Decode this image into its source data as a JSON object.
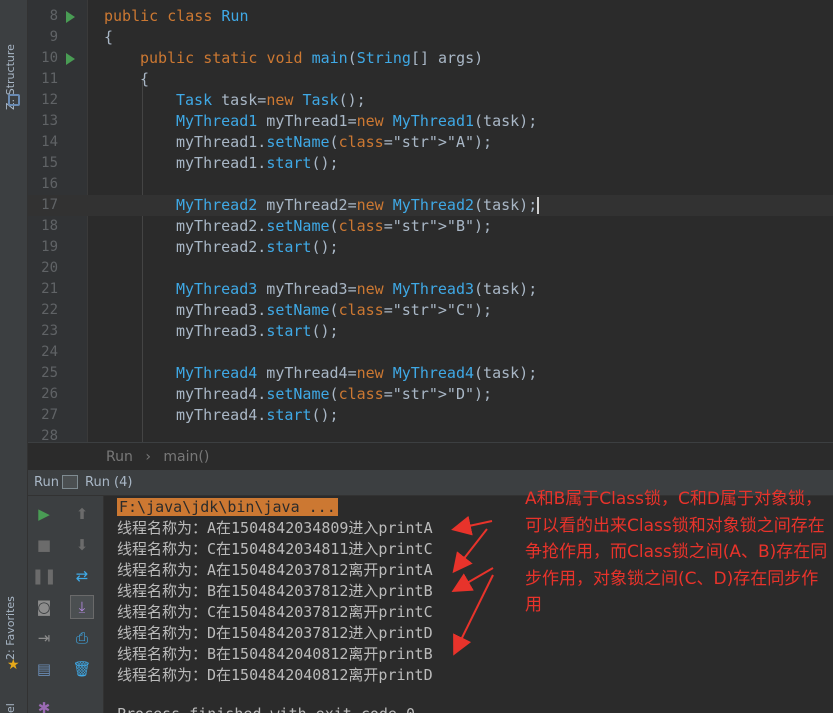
{
  "sidebar": {
    "structure_label": "Z: Structure",
    "favorites_label": "2: Favorites",
    "bottom_label": "el"
  },
  "editor": {
    "lines": [
      {
        "num": "8",
        "code": "public class Run"
      },
      {
        "num": "9",
        "code": "{"
      },
      {
        "num": "10",
        "code": "public static void main(String[] args)"
      },
      {
        "num": "11",
        "code": "{"
      },
      {
        "num": "12",
        "code": "Task task=new Task();"
      },
      {
        "num": "13",
        "code": "MyThread1 myThread1=new MyThread1(task);"
      },
      {
        "num": "14",
        "code": "myThread1.setName(\"A\");"
      },
      {
        "num": "15",
        "code": "myThread1.start();"
      },
      {
        "num": "16",
        "code": ""
      },
      {
        "num": "17",
        "code": "MyThread2 myThread2=new MyThread2(task);"
      },
      {
        "num": "18",
        "code": "myThread2.setName(\"B\");"
      },
      {
        "num": "19",
        "code": "myThread2.start();"
      },
      {
        "num": "20",
        "code": ""
      },
      {
        "num": "21",
        "code": "MyThread3 myThread3=new MyThread3(task);"
      },
      {
        "num": "22",
        "code": "myThread3.setName(\"C\");"
      },
      {
        "num": "23",
        "code": "myThread3.start();"
      },
      {
        "num": "24",
        "code": ""
      },
      {
        "num": "25",
        "code": "MyThread4 myThread4=new MyThread4(task);"
      },
      {
        "num": "26",
        "code": "myThread4.setName(\"D\");"
      },
      {
        "num": "27",
        "code": "myThread4.start();"
      },
      {
        "num": "28",
        "code": ""
      }
    ]
  },
  "breadcrumb": {
    "item1": "Run",
    "sep": "›",
    "item2": "main()"
  },
  "run_panel": {
    "label": "Run",
    "tab": "Run (4)"
  },
  "console": {
    "command": "F:\\java\\jdk\\bin\\java ...",
    "lines": [
      "线程名称为：A在1504842034809进入printA",
      "线程名称为：C在1504842034811进入printC",
      "线程名称为：A在1504842037812离开printA",
      "线程名称为：B在1504842037812进入printB",
      "线程名称为：C在1504842037812离开printC",
      "线程名称为：D在1504842037812进入printD",
      "线程名称为：B在1504842040812离开printB",
      "线程名称为：D在1504842040812离开printD"
    ],
    "footer": "Process finished with exit code 0"
  },
  "annotation": {
    "text": "A和B属于Class锁，C和D属于对象锁，可以看的出来Class锁和对象锁之间存在争抢作用，而Class锁之间(A、B)存在同步作用，对象锁之间(C、D)存在同步作用",
    "color": "#e8332b"
  }
}
